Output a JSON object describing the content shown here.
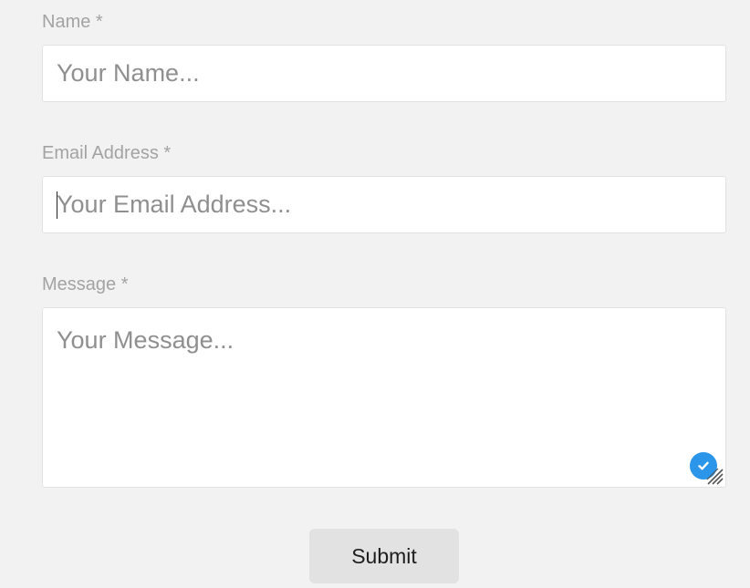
{
  "form": {
    "name": {
      "label": "Name *",
      "placeholder": "Your Name...",
      "value": ""
    },
    "email": {
      "label": "Email Address *",
      "placeholder": "Your Email Address...",
      "value": ""
    },
    "message": {
      "label": "Message *",
      "placeholder": "Your Message...",
      "value": ""
    },
    "submit_label": "Submit"
  },
  "icons": {
    "grammar_check": "check-circle-icon",
    "resize": "resize-grip-icon"
  },
  "colors": {
    "background": "#f2f2f2",
    "label": "#a3a3a3",
    "placeholder": "#8f8f8f",
    "input_border": "#e2e2e2",
    "button_background": "#e2e2e2",
    "check_badge": "#2b95e9"
  }
}
